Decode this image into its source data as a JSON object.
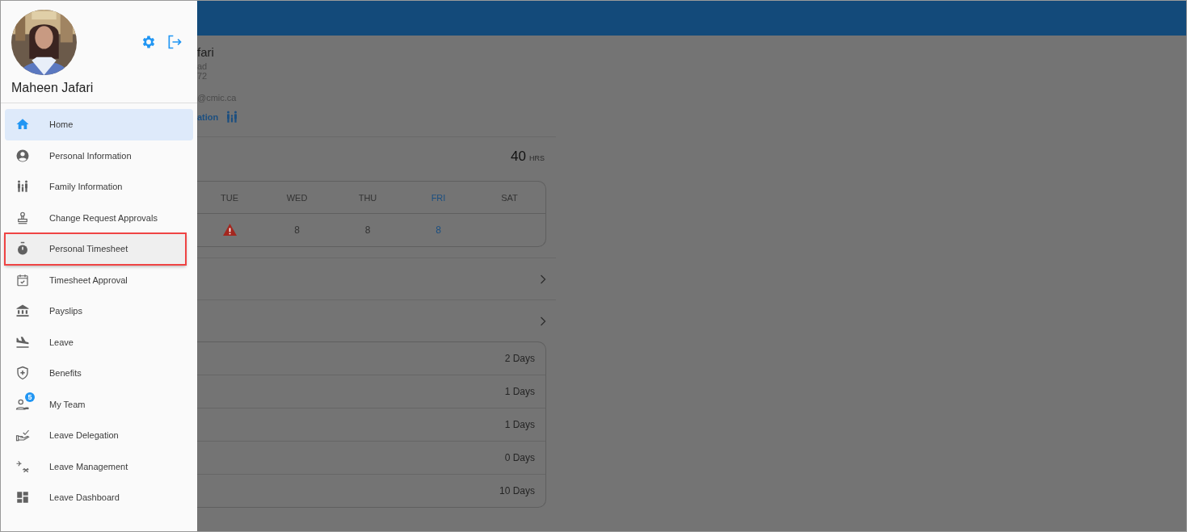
{
  "drawer": {
    "user_name": "Maheen Jafari",
    "items": [
      {
        "label": "Home",
        "selected": true,
        "highlighted": false
      },
      {
        "label": "Personal Information",
        "selected": false,
        "highlighted": false
      },
      {
        "label": "Family Information",
        "selected": false,
        "highlighted": false
      },
      {
        "label": "Change Request Approvals",
        "selected": false,
        "highlighted": false
      },
      {
        "label": "Personal Timesheet",
        "selected": false,
        "highlighted": true
      },
      {
        "label": "Timesheet Approval",
        "selected": false,
        "highlighted": false
      },
      {
        "label": "Payslips",
        "selected": false,
        "highlighted": false
      },
      {
        "label": "Leave",
        "selected": false,
        "highlighted": false
      },
      {
        "label": "Benefits",
        "selected": false,
        "highlighted": false
      },
      {
        "label": "My Team",
        "selected": false,
        "highlighted": false,
        "badge": "5"
      },
      {
        "label": "Leave Delegation",
        "selected": false,
        "highlighted": false
      },
      {
        "label": "Leave Management",
        "selected": false,
        "highlighted": false
      },
      {
        "label": "Leave Dashboard",
        "selected": false,
        "highlighted": false
      }
    ]
  },
  "profile": {
    "name": "fari",
    "line_1": "ad",
    "line_2": "72",
    "email": "@cmic.ca",
    "link": "ation"
  },
  "timesheet": {
    "total": "40",
    "unit": "HRS",
    "days": [
      {
        "label": "TUE",
        "warning": true,
        "today": false
      },
      {
        "label": "WED",
        "value": "8",
        "warning": false,
        "today": false
      },
      {
        "label": "THU",
        "value": "8",
        "warning": false,
        "today": false
      },
      {
        "label": "FRI",
        "value": "8",
        "warning": false,
        "today": true
      },
      {
        "label": "SAT",
        "warning": false,
        "today": false
      }
    ]
  },
  "leave_balances": [
    "2 Days",
    "1 Days",
    "1 Days",
    "0 Days",
    "10 Days"
  ]
}
